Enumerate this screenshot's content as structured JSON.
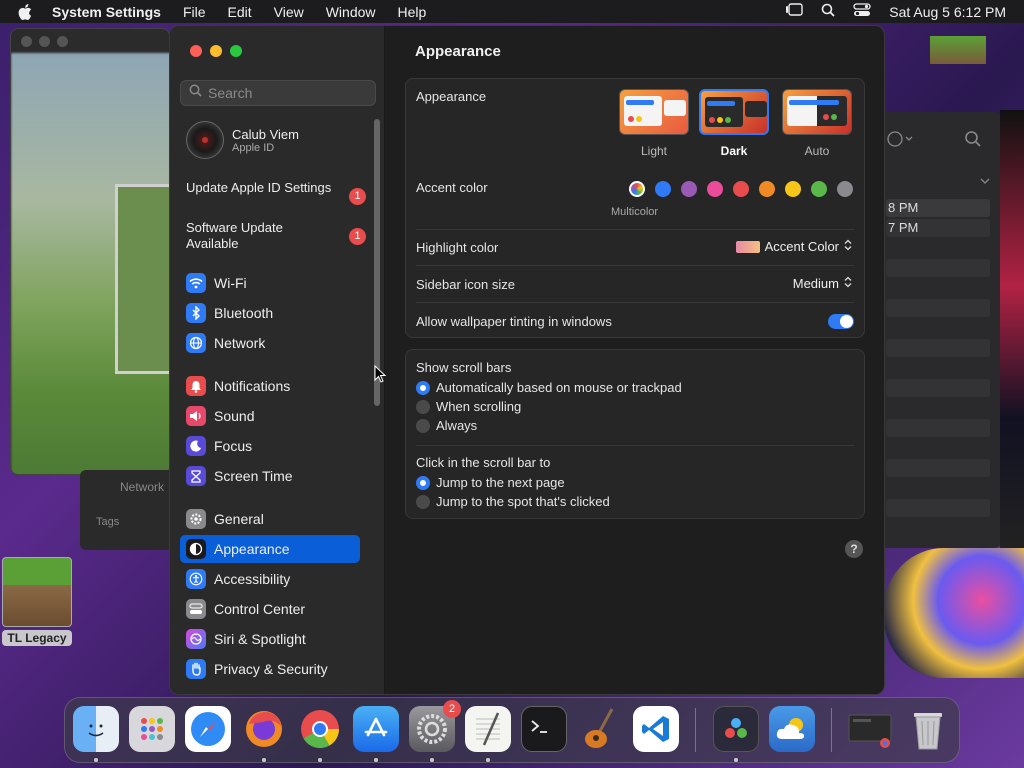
{
  "menubar": {
    "app_name": "System Settings",
    "items": [
      "File",
      "Edit",
      "View",
      "Window",
      "Help"
    ],
    "datetime": "Sat Aug 5  6:12 PM"
  },
  "background": {
    "behind_label_1": "Network",
    "behind_label_2": "Tags",
    "right_rows": [
      "8 PM",
      "7 PM"
    ],
    "desktop_icon_label": "TL Legacy"
  },
  "sidebar": {
    "search_placeholder": "Search",
    "user_name": "Calub Viem",
    "user_sub": "Apple ID",
    "notices": [
      {
        "text": "Update Apple ID Settings",
        "badge": "1"
      },
      {
        "text": "Software Update Available",
        "badge": "1"
      }
    ],
    "items": [
      {
        "label": "Wi-Fi",
        "icon": "wifi-icon",
        "color": "#2f7bf5"
      },
      {
        "label": "Bluetooth",
        "icon": "bluetooth-icon",
        "color": "#2f7bf5"
      },
      {
        "label": "Network",
        "icon": "globe-icon",
        "color": "#2f7bf5"
      },
      {
        "label": "Notifications",
        "icon": "bell-icon",
        "color": "#e84c4c"
      },
      {
        "label": "Sound",
        "icon": "speaker-icon",
        "color": "#e8486a"
      },
      {
        "label": "Focus",
        "icon": "moon-icon",
        "color": "#5a4ad8"
      },
      {
        "label": "Screen Time",
        "icon": "hourglass-icon",
        "color": "#5a4ad8"
      },
      {
        "label": "General",
        "icon": "gear-icon",
        "color": "#8a8a8e"
      },
      {
        "label": "Appearance",
        "icon": "appearance-icon",
        "color": "#1a1a1a"
      },
      {
        "label": "Accessibility",
        "icon": "accessibility-icon",
        "color": "#2f7bf5"
      },
      {
        "label": "Control Center",
        "icon": "control-center-icon",
        "color": "#8a8a8e"
      },
      {
        "label": "Siri & Spotlight",
        "icon": "siri-icon",
        "color": "#b44ad8"
      },
      {
        "label": "Privacy & Security",
        "icon": "hand-icon",
        "color": "#2f7bf5"
      }
    ],
    "active": "Appearance"
  },
  "content": {
    "title": "Appearance",
    "appearance_label": "Appearance",
    "themes": [
      "Light",
      "Dark",
      "Auto"
    ],
    "selected_theme": "Dark",
    "accent_label": "Accent color",
    "accent_colors": [
      "#c05bd0",
      "#2f7bf5",
      "#9b59b6",
      "#e84c9b",
      "#e84c4c",
      "#f08a24",
      "#f5c518",
      "#5ab84a",
      "#8a8a8e"
    ],
    "accent_caption": "Multicolor",
    "highlight_label": "Highlight color",
    "highlight_value": "Accent Color",
    "sidebar_icon_label": "Sidebar icon size",
    "sidebar_icon_value": "Medium",
    "tinting_label": "Allow wallpaper tinting in windows",
    "tinting_on": true,
    "scroll_title": "Show scroll bars",
    "scroll_options": [
      "Automatically based on mouse or trackpad",
      "When scrolling",
      "Always"
    ],
    "click_title": "Click in the scroll bar to",
    "click_options": [
      "Jump to the next page",
      "Jump to the spot that's clicked"
    ],
    "help": "?"
  },
  "dock": {
    "apps": [
      "finder",
      "launchpad",
      "safari",
      "firefox",
      "chrome",
      "app-store",
      "system-settings",
      "textedit",
      "terminal",
      "garageband",
      "vscode",
      "davinci-resolve",
      "weather",
      "window-preview",
      "trash"
    ],
    "settings_badge": "2"
  }
}
